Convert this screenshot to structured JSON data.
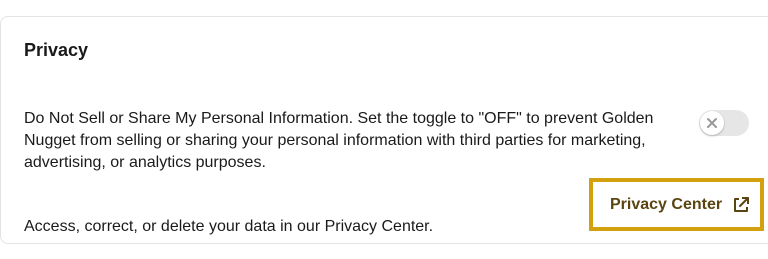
{
  "privacy": {
    "title": "Privacy",
    "do_not_sell_text": "Do Not Sell or Share My Personal Information. Set the toggle to \"OFF\" to prevent Golden Nugget from selling or sharing your personal information with third parties for marketing, advertising, or analytics purposes.",
    "toggle_state": "OFF",
    "access_text": "Access, correct, or delete your data in our Privacy Center.",
    "privacy_center_label": "Privacy Center",
    "icons": {
      "toggle_knob": "close-x-icon",
      "privacy_center": "external-link-icon"
    },
    "colors": {
      "link_text": "#5a4510",
      "link_highlight_border": "#d4a10e",
      "toggle_track_off": "#e6e6e6"
    }
  }
}
